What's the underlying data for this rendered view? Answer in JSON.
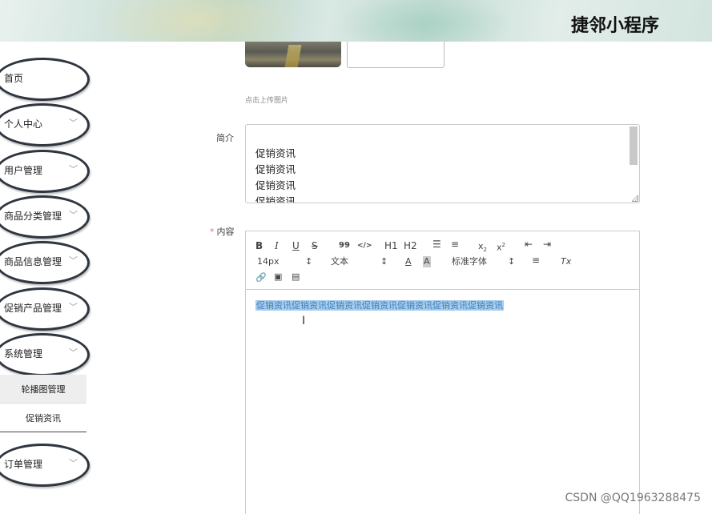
{
  "header": {
    "title": "捷邻小程序"
  },
  "sidebar": {
    "items": [
      {
        "label": "首页",
        "chevron": false
      },
      {
        "label": "个人中心",
        "chevron": true
      },
      {
        "label": "用户管理",
        "chevron": true
      },
      {
        "label": "商品分类管理",
        "chevron": true
      },
      {
        "label": "商品信息管理",
        "chevron": true
      },
      {
        "label": "促销产品管理",
        "chevron": true
      },
      {
        "label": "系统管理",
        "chevron": true
      },
      {
        "label": "订单管理",
        "chevron": true
      }
    ],
    "submenu": [
      {
        "label": "轮播图管理",
        "active": true
      },
      {
        "label": "促销资讯",
        "active": false
      }
    ],
    "chevron_glyph": "﹀"
  },
  "form": {
    "upload_hint": "点击上传图片",
    "intro_label": "简介",
    "intro_lines": [
      "促销资讯",
      "促销资讯",
      "促销资讯",
      "促销资讯"
    ],
    "content_label": "内容",
    "content_required_mark": "*",
    "editor": {
      "toolbar": {
        "bold": "B",
        "italic": "I",
        "underline": "U",
        "strike": "S",
        "quote": "99",
        "code": "</>",
        "h1": "H1",
        "h2": "H2",
        "font_size": "14px",
        "text_type": "文本",
        "font_family": "标准字体",
        "color_icon": "A",
        "bg_icon": "A",
        "clear_icon": "Tx"
      },
      "selected_text": "促销资讯促销资讯促销资讯促销资讯促销资讯促销资讯促销资讯"
    }
  },
  "watermark": "CSDN @QQ1963288475",
  "colors": {
    "required": "#f56c6c",
    "selection": "#a9cde9",
    "sidebar_border": "#2f3640"
  }
}
